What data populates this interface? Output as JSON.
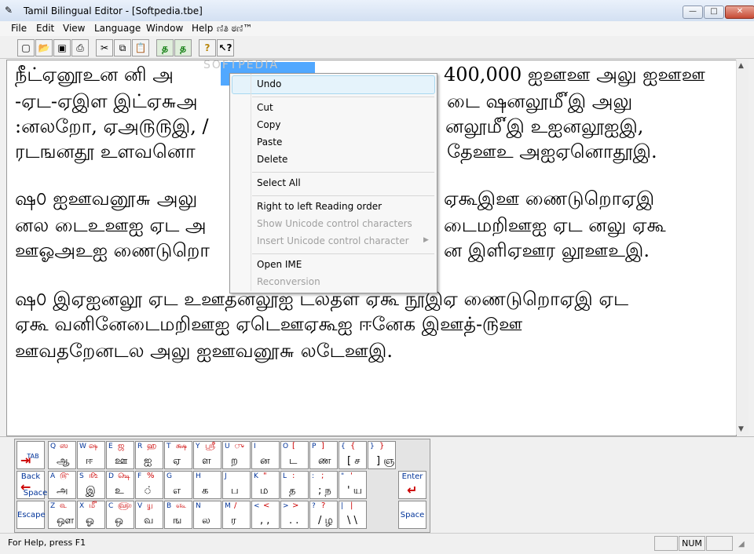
{
  "window": {
    "title": "Tamil Bilingual Editor - [Softpedia.tbe]",
    "controls": {
      "minimize": "—",
      "maximize": "□",
      "close": "✕"
    }
  },
  "menubar": {
    "items": [
      "File",
      "Edit",
      "View",
      "Language",
      "Window",
      "Help",
      "ಣಿತಿ ಠಣಿ™"
    ]
  },
  "toolbar": {
    "buttons": [
      "new",
      "open",
      "save",
      "print",
      "cut",
      "copy",
      "paste",
      "tamil-1",
      "tamil-2",
      "help",
      "context-help"
    ],
    "tamil_1": "த",
    "tamil_2": "த"
  },
  "document": {
    "lines": [
      "நீட்ஏனூஉன னி அ",
      "-ஏட-ஏஇள இட்ஏ௬அ",
      ":னலறோ, ஏஅ௫௫இ, /",
      "ரடஙனதூ உளவனொ",
      "",
      "ஷ௦ ஐஊவனூ௬ அலு",
      "னல டைஉஊஐ ஏட அ",
      "ஊஓஅஉஐ ணைடுறொ",
      "",
      "ஷ௦ இஏஐனலூ ஏட உஊதனலூஐ டலதள ஏகூ நூஇஏ ணைடுறொஏஇ ஏட",
      "ஏகூ வனினேடைமறிஊஐ ஏடெஊஏகூஐ ஈனேக இஊத்-௫ஊ",
      "ஊவதறேனடல அலு ஐஊவனூ௬ லடேஊஇ."
    ],
    "right_fragments": [
      "400,000 ஐஊஊ அலு ஐஊஊ",
      "டை ஷனலூ௴இ அலு",
      "னலூ௴இ உஐனலூஐஇ,",
      "தேஊஉ அஐஏனொதூஇ.",
      "",
      "ஏகூஇஊ ணைடுறொஏஇ",
      "டைமறிஊஐ ஏட னலு ஏகூ",
      "ன இளிஏஊர லூஊஉஇ."
    ],
    "watermark": "SOFTPEDIA"
  },
  "context_menu": {
    "items": [
      {
        "label": "Undo",
        "enabled": true
      },
      {
        "label": "Cut",
        "enabled": true
      },
      {
        "label": "Copy",
        "enabled": true
      },
      {
        "label": "Paste",
        "enabled": true
      },
      {
        "label": "Delete",
        "enabled": true
      },
      {
        "label": "Select All",
        "enabled": true
      },
      {
        "label": "Right to left Reading order",
        "enabled": true
      },
      {
        "label": "Show Unicode control characters",
        "enabled": false
      },
      {
        "label": "Insert Unicode control character",
        "enabled": false
      },
      {
        "label": "Open IME",
        "enabled": true
      },
      {
        "label": "Reconversion",
        "enabled": false
      }
    ]
  },
  "keyboard": {
    "tab_label": "TAB",
    "back_label": "Back",
    "space_label_small": "Space",
    "escape_label": "Escape",
    "enter_label": "Enter",
    "space_label": "Space",
    "rows": [
      [
        {
          "k": "Q",
          "t": "ஸ",
          "b": "ஆ"
        },
        {
          "k": "W",
          "t": "ஷ",
          "b": "ஈ"
        },
        {
          "k": "E",
          "t": "ஜ",
          "b": "ஊ"
        },
        {
          "k": "R",
          "t": "ஹ",
          "b": "ஐ"
        },
        {
          "k": "T",
          "t": "க்ஷ",
          "b": "ஏ"
        },
        {
          "k": "Y",
          "t": "ஸ்ரீ",
          "b": "ள"
        },
        {
          "k": "U",
          "t": "ு",
          "b": "ற"
        },
        {
          "k": "I",
          "t": "",
          "b": "ன"
        },
        {
          "k": "O",
          "t": "[",
          "b": "ட"
        },
        {
          "k": "P",
          "t": "]",
          "b": "ண"
        },
        {
          "k": "{",
          "t": "{",
          "b": "[ ச"
        },
        {
          "k": "}",
          "t": "}",
          "b": "] ஞ"
        }
      ],
      [
        {
          "k": "A",
          "t": "௹",
          "b": "அ"
        },
        {
          "k": "S",
          "t": "௺",
          "b": "இ"
        },
        {
          "k": "D",
          "t": "௸",
          "b": "உ"
        },
        {
          "k": "F",
          "t": "%",
          "b": "்"
        },
        {
          "k": "G",
          "t": "",
          "b": "எ"
        },
        {
          "k": "H",
          "t": "",
          "b": "க"
        },
        {
          "k": "J",
          "t": "",
          "b": "ப"
        },
        {
          "k": "K",
          "t": "\"",
          "b": "ம"
        },
        {
          "k": "L",
          "t": ":",
          "b": "த"
        },
        {
          "k": ":",
          "t": ";",
          "b": "; ந"
        },
        {
          "k": "\"",
          "t": "'",
          "b": "' ய"
        }
      ],
      [
        {
          "k": "Z",
          "t": "௳",
          "b": "ஔ"
        },
        {
          "k": "X",
          "t": "௴",
          "b": "ஓ"
        },
        {
          "k": "C",
          "t": "௵",
          "b": "ஒ"
        },
        {
          "k": "V",
          "t": "௶",
          "b": "வ"
        },
        {
          "k": "B",
          "t": "௷",
          "b": "ங"
        },
        {
          "k": "N",
          "t": "",
          "b": "ல"
        },
        {
          "k": "M",
          "t": "/",
          "b": "ர"
        },
        {
          "k": "<",
          "t": "<",
          "b": ", ,"
        },
        {
          "k": ">",
          "t": ">",
          "b": ". ."
        },
        {
          "k": "?",
          "t": "?",
          "b": "/ ழ"
        },
        {
          "k": "|",
          "t": "|",
          "b": "\\ \\"
        }
      ]
    ]
  },
  "statusbar": {
    "message": "For Help, press F1",
    "indicators": [
      "",
      "NUM",
      ""
    ]
  }
}
